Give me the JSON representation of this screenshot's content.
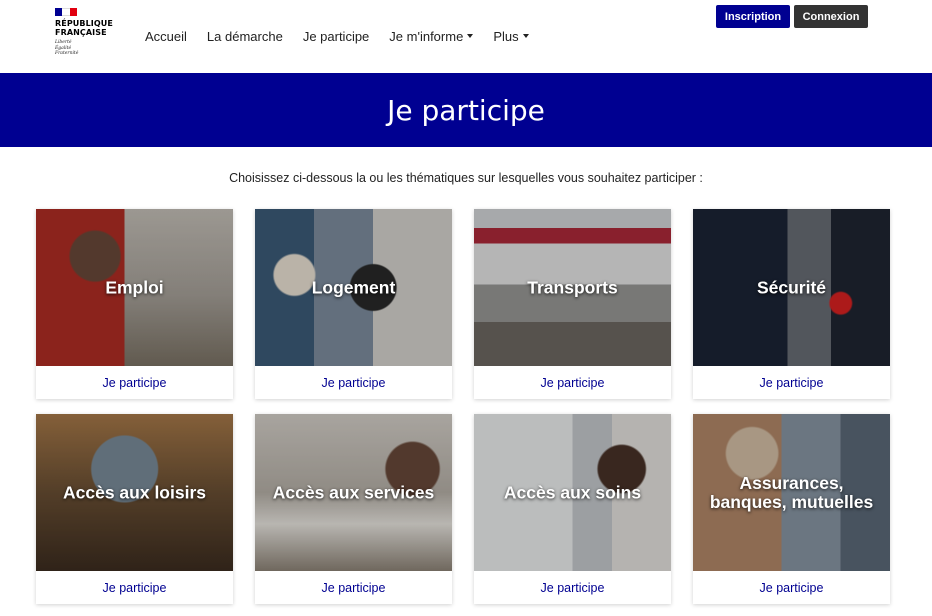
{
  "logo": {
    "line1": "RÉPUBLIQUE",
    "line2": "FRANÇAISE",
    "motto1": "Liberté",
    "motto2": "Égalité",
    "motto3": "Fraternité"
  },
  "nav": {
    "items": [
      {
        "label": "Accueil",
        "dropdown": false
      },
      {
        "label": "La démarche",
        "dropdown": false
      },
      {
        "label": "Je participe",
        "dropdown": false
      },
      {
        "label": "Je m'informe",
        "dropdown": true
      },
      {
        "label": "Plus",
        "dropdown": true
      }
    ]
  },
  "auth": {
    "inscription_label": "Inscription",
    "connexion_label": "Connexion"
  },
  "banner": {
    "title": "Je participe"
  },
  "intro": {
    "text": "Choisissez ci-dessous la ou les thématiques sur lesquelles vous souhaitez participer :"
  },
  "cards": [
    {
      "title": "Emploi",
      "link": "Je participe"
    },
    {
      "title": "Logement",
      "link": "Je participe"
    },
    {
      "title": "Transports",
      "link": "Je participe"
    },
    {
      "title": "Sécurité",
      "link": "Je participe"
    },
    {
      "title": "Accès aux loisirs",
      "link": "Je participe"
    },
    {
      "title": "Accès aux services",
      "link": "Je participe"
    },
    {
      "title": "Accès aux soins",
      "link": "Je participe"
    },
    {
      "title": "Assurances, banques, mutuelles",
      "link": "Je participe"
    }
  ],
  "colors": {
    "primary_blue": "#000091",
    "connexion_dark": "#333333",
    "flag_red": "#e1000f"
  }
}
